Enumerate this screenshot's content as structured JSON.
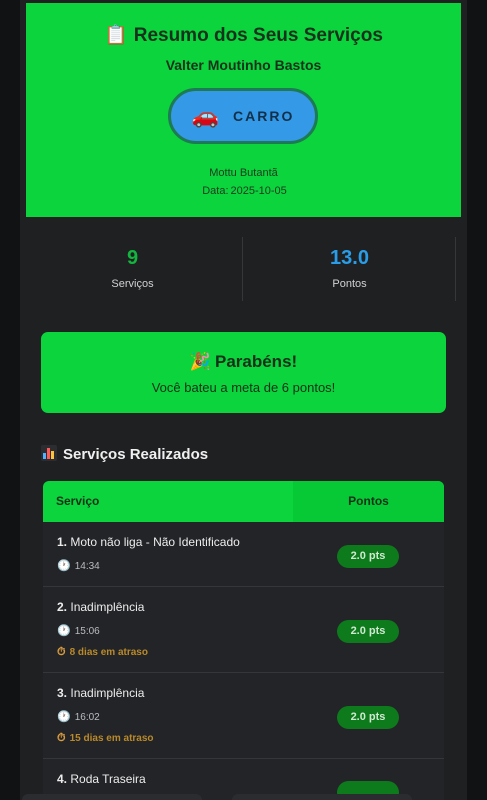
{
  "header": {
    "icon": "clipboard-icon",
    "title": "Resumo dos Seus Serviços",
    "name": "Valter Moutinho Bastos",
    "vehicle_icon": "car-icon",
    "vehicle_label": "CARRO",
    "branch": "Mottu Butantã",
    "date_label": "Data:",
    "date_value": "2025-10-05"
  },
  "stats": [
    {
      "value": "9",
      "label": "Serviços",
      "color": "#12b53e"
    },
    {
      "value": "13.0",
      "label": "Pontos",
      "color": "#2a9de8"
    }
  ],
  "congrats": {
    "icon": "party-popper-icon",
    "title": "Parabéns!",
    "message": "Você bateu a meta de 6 pontos!"
  },
  "services": {
    "icon": "bar-chart-icon",
    "title": "Serviços Realizados",
    "col_service": "Serviço",
    "col_points": "Pontos",
    "rows": [
      {
        "num": "1.",
        "desc": "Moto não liga - Não Identificado",
        "time": "14:34",
        "late": "",
        "points": "2.0 pts"
      },
      {
        "num": "2.",
        "desc": "Inadimplência",
        "time": "15:06",
        "late": "8 dias em atraso",
        "points": "2.0 pts"
      },
      {
        "num": "3.",
        "desc": "Inadimplência",
        "time": "16:02",
        "late": "15 dias em atraso",
        "points": "2.0 pts"
      },
      {
        "num": "4.",
        "desc": "Roda Traseira",
        "time": "",
        "late": "",
        "points": ""
      }
    ]
  },
  "colors": {
    "accent": "#0bd43c",
    "background": "#1f2022",
    "points_badge": "#0d7a1c"
  }
}
